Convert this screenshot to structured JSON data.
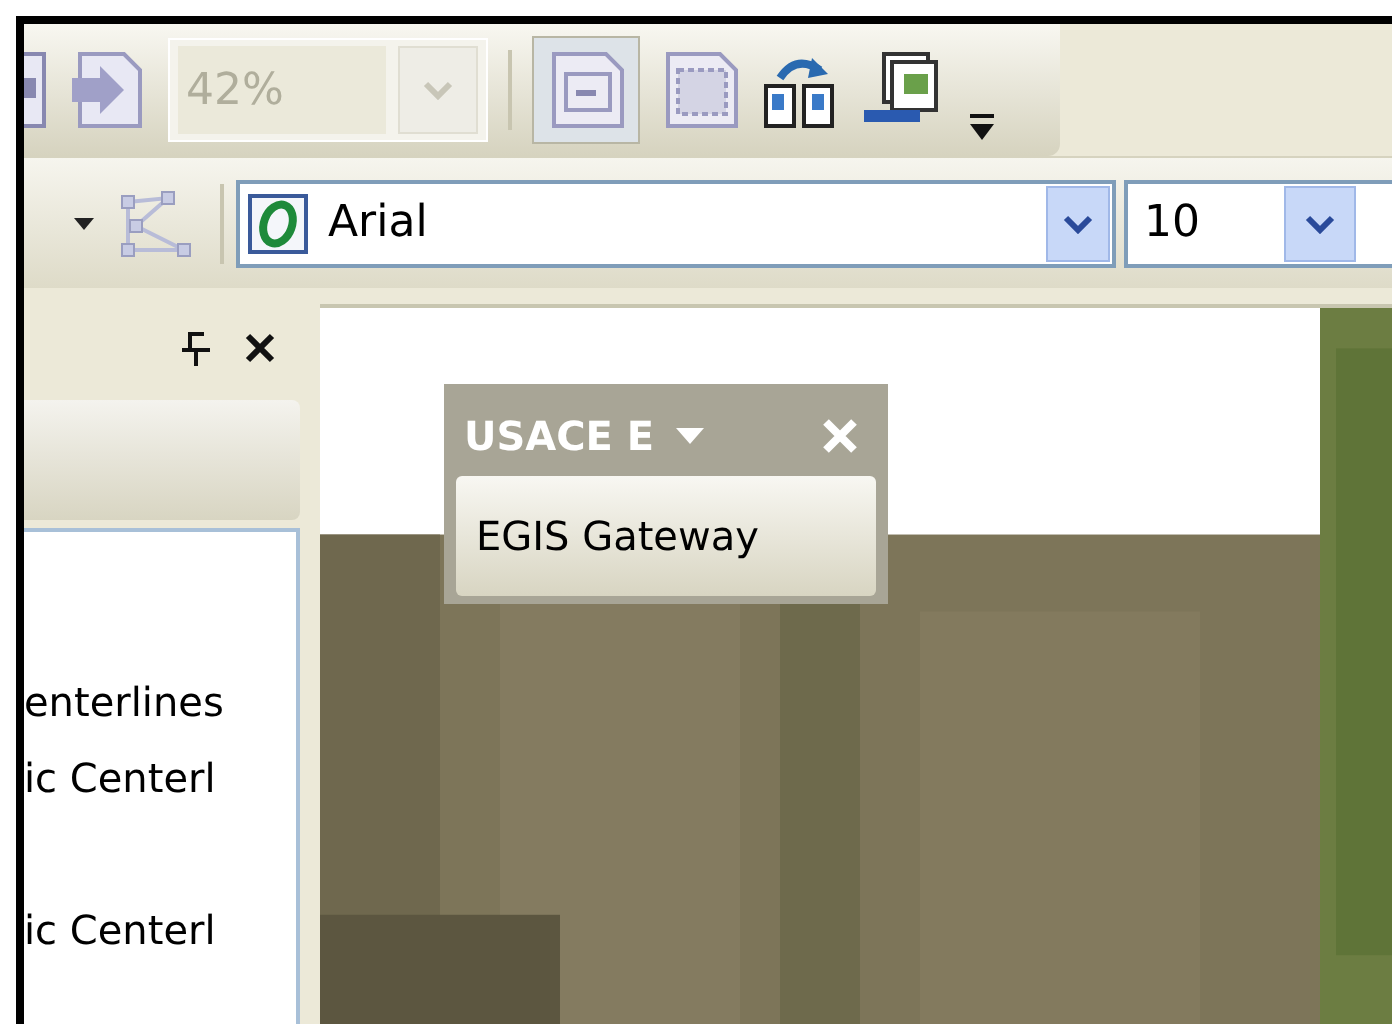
{
  "standard_toolbar": {
    "zoom_field": {
      "value": "42%",
      "disabled": true
    },
    "zoom_dropdown": {
      "disabled": true
    },
    "layout_view_button": {
      "pressed": true
    }
  },
  "draw_toolbar": {
    "font_field": {
      "value": "Arial"
    },
    "size_field": {
      "value": "10"
    }
  },
  "side_panel": {
    "items": [
      {
        "label": "enterlines"
      },
      {
        "label": "ic Centerl"
      },
      {
        "label": "ic Centerl"
      }
    ]
  },
  "map": {
    "kind": "picture",
    "floating_toolbar": {
      "title": "USACE E",
      "button": "EGIS Gateway"
    }
  }
}
